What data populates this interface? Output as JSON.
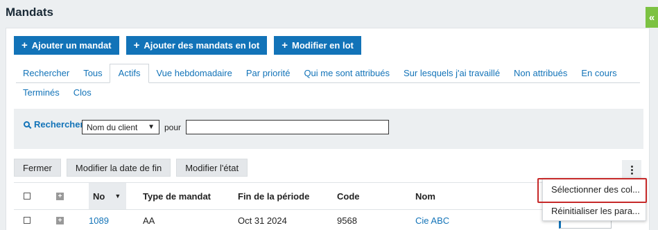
{
  "page": {
    "title": "Mandats"
  },
  "toolbar": {
    "buttons": [
      {
        "label": "Ajouter un mandat"
      },
      {
        "label": "Ajouter des mandats en lot"
      },
      {
        "label": "Modifier en lot"
      }
    ]
  },
  "tabs": {
    "row1": [
      "Rechercher",
      "Tous",
      "Actifs",
      "Vue hebdomadaire",
      "Par priorité",
      "Qui me sont attribués",
      "Sur lesquels j'ai travaillé",
      "Non attribués",
      "En cours"
    ],
    "row2": [
      "Terminés",
      "Clos"
    ],
    "active": "Actifs"
  },
  "search": {
    "label": "Rechercher",
    "field_select": "Nom du client",
    "connector": "pour",
    "value": ""
  },
  "actions": {
    "close": "Fermer",
    "edit_end_date": "Modifier la date de fin",
    "edit_status": "Modifier l'état"
  },
  "table": {
    "columns": [
      "No",
      "Type de mandat",
      "Fin de la période",
      "Code",
      "Nom"
    ],
    "rows": [
      {
        "no": "1089",
        "type": "AA",
        "period_end": "Oct 31 2024",
        "code": "9568",
        "name": "Cie ABC"
      }
    ]
  },
  "menu": {
    "items": [
      "Sélectionner des col...",
      "Réinitialiser les para..."
    ]
  },
  "colors": {
    "accent": "#1273b8",
    "collapse": "#7cc242",
    "highlight": "#c62828"
  },
  "icons": {
    "collapse": "double-chevron-left-icon",
    "search": "magnifier-icon",
    "more": "kebab-vertical-icon",
    "expand": "plus-square-icon"
  }
}
